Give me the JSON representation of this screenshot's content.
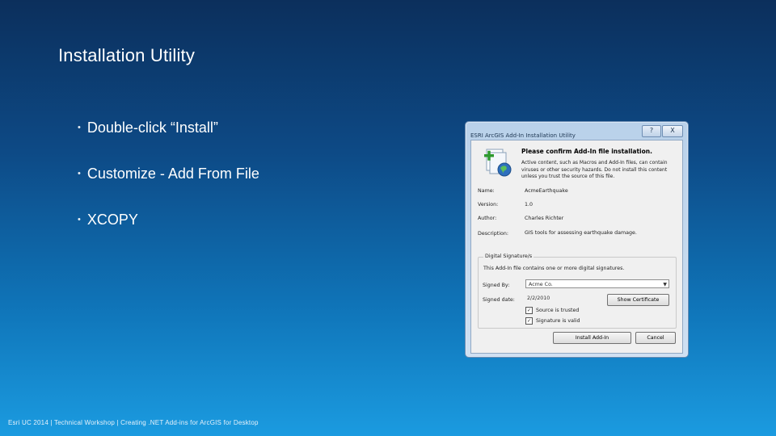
{
  "slide": {
    "title": "Installation Utility",
    "bullets": [
      "Double-click “Install”",
      "Customize - Add From File",
      "XCOPY"
    ],
    "footer": "Esri UC 2014 | Technical Workshop | Creating .NET Add-ins for ArcGIS for Desktop"
  },
  "dialog": {
    "title": "ESRI ArcGIS Add-In Installation Utility",
    "help_label": "?",
    "close_label": "X",
    "heading": "Please confirm Add-In file installation.",
    "warning": "Active content, such as Macros and Add-In files, can contain viruses or other security hazards. Do not install this content unless you trust the source of this file.",
    "fields": [
      {
        "label": "Name:",
        "value": "AcmeEarthquake"
      },
      {
        "label": "Version:",
        "value": "1.0"
      },
      {
        "label": "Author:",
        "value": "Charles Richter"
      },
      {
        "label": "Description:",
        "value": "GIS tools for assessing earthquake damage."
      }
    ],
    "signature": {
      "legend": "Digital Signature/s",
      "description": "This Add-In file contains one or more digital signatures.",
      "signed_by_label": "Signed By:",
      "signed_by_value": "Acme Co.",
      "signed_date_label": "Signed date:",
      "signed_date_value": "2/2/2010",
      "show_certificate_label": "Show Certificate",
      "source_trusted_label": "Source is trusted",
      "signature_valid_label": "Signature is valid"
    },
    "install_label": "Install Add-In",
    "cancel_label": "Cancel"
  }
}
